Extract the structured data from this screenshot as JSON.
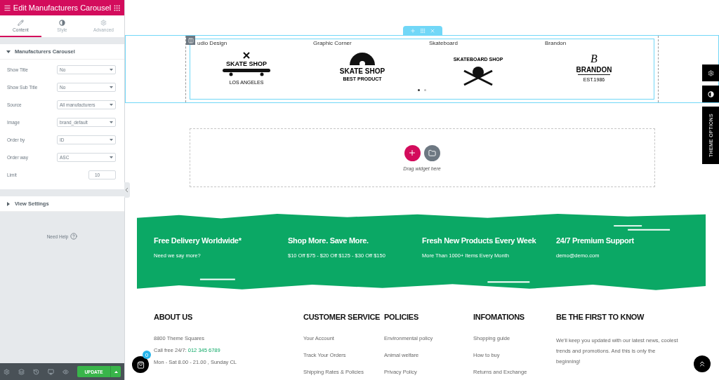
{
  "panel": {
    "title": "Edit Manufacturers Carousel",
    "tabs": [
      {
        "label": "Content",
        "selected": true
      },
      {
        "label": "Style",
        "selected": false
      },
      {
        "label": "Advanced",
        "selected": false
      }
    ],
    "sections": [
      {
        "title": "Manufacturers Carousel",
        "expanded": true,
        "controls": [
          {
            "kind": "select",
            "label": "Show Title",
            "value": "No"
          },
          {
            "kind": "select",
            "label": "Show Sub Title",
            "value": "No"
          },
          {
            "kind": "select",
            "label": "Source",
            "value": "All manufacturers"
          },
          {
            "kind": "select",
            "label": "Image",
            "value": "brand_default"
          },
          {
            "kind": "select",
            "label": "Order by",
            "value": "ID"
          },
          {
            "kind": "select",
            "label": "Order way",
            "value": "ASC"
          },
          {
            "kind": "number",
            "label": "Limit",
            "value": "10"
          }
        ]
      },
      {
        "title": "View Settings",
        "expanded": false
      }
    ],
    "help": "Need Help",
    "update_button": "UPDATE"
  },
  "carousel": {
    "brands": [
      {
        "name": "udio Design",
        "main": "SKATE SHOP",
        "sub": "LOS ANGELES"
      },
      {
        "name": "Graphic Corner",
        "main": "SKATE SHOP",
        "sub": "BEST PRODUCT"
      },
      {
        "name": "Skateboard",
        "main": "SKATEBOARD SHOP"
      },
      {
        "name": "Brandon",
        "mark": "B",
        "main": "BRANDON",
        "sub": "EST.1986"
      }
    ],
    "dots": [
      {
        "selected": true
      },
      {
        "selected": false
      }
    ]
  },
  "drop_zone": {
    "hint": "Drag widget here"
  },
  "side_tab": {
    "label": "THEME OPTIONS"
  },
  "features": [
    {
      "title": "Free Delivery Worldwide*",
      "text": "Need we say more?"
    },
    {
      "title": "Shop More. Save More.",
      "text": "$10 Off $75 - $20 Off $125 - $30 Off $150"
    },
    {
      "title": "Fresh New Products Every Week",
      "text": "More Than 1000+ Items Every Month"
    },
    {
      "title": "24/7 Premium Support",
      "text": "demo@demo.com"
    }
  ],
  "footer": [
    {
      "title": "ABOUT US",
      "kind": "about",
      "lines": [
        "8800 Theme Squares",
        "Call free 24/7: **012 345 6789**",
        "Mon - Sat 8.00 - 21.00 , Sunday CL"
      ]
    },
    {
      "title": "CUSTOMER SERVICE",
      "kind": "links",
      "lines": [
        "Your Account",
        "Track Your Orders",
        "Shipping Rates & Policies"
      ]
    },
    {
      "title": "POLICIES",
      "kind": "links",
      "lines": [
        "Environmental policy",
        "Animal welfare",
        "Privacy Policy"
      ]
    },
    {
      "title": "INFOMATIONS",
      "kind": "links",
      "lines": [
        "Shopping guide",
        "How to buy",
        "Returns and Exchange"
      ]
    },
    {
      "title": "BE THE FIRST TO KNOW",
      "kind": "text",
      "lines": [
        "We'll keep you updated with our latest news, coolest trends and promotions. And this is only the beginning!"
      ]
    }
  ],
  "cart": {
    "count": "0"
  }
}
